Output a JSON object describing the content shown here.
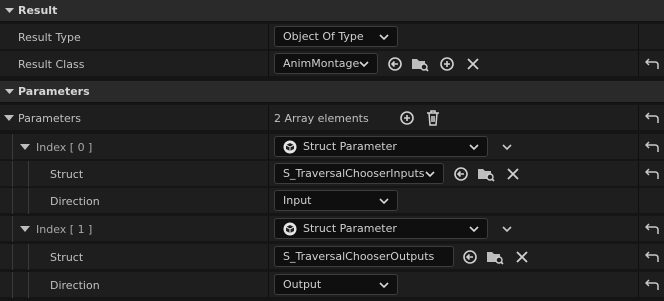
{
  "sections": {
    "result": {
      "label": "Result"
    },
    "parameters": {
      "label": "Parameters"
    }
  },
  "result_type": {
    "label": "Result Type",
    "value": "Object Of Type"
  },
  "result_class": {
    "label": "Result Class",
    "value": "AnimMontage"
  },
  "params": {
    "label": "Parameters",
    "count_text": "2 Array elements"
  },
  "index0": {
    "label": "Index [ 0 ]",
    "type_value": "Struct Parameter",
    "struct_label": "Struct",
    "struct_value": "S_TraversalChooserInputs",
    "direction_label": "Direction",
    "direction_value": "Input"
  },
  "index1": {
    "label": "Index [ 1 ]",
    "type_value": "Struct Parameter",
    "struct_label": "Struct",
    "struct_value": "S_TraversalChooserOutputs",
    "direction_label": "Direction",
    "direction_value": "Output"
  },
  "colors": {
    "bg": "#151515",
    "row": "#1e1e1e",
    "header": "#2a2a2a",
    "text": "#c0c0c0"
  }
}
